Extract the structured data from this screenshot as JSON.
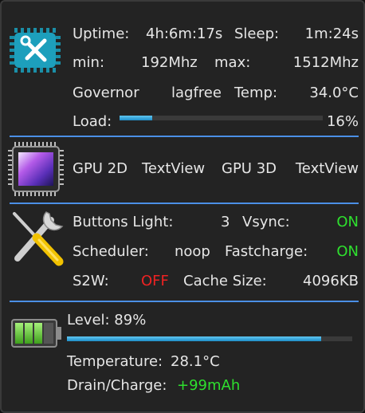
{
  "cpu": {
    "uptime_label": "Uptime:",
    "uptime_value": "4h:6m:17s",
    "sleep_label": "Sleep:",
    "sleep_value": "1m:24s",
    "min_label": "min:",
    "min_value": "192Mhz",
    "max_label": "max:",
    "max_value": "1512Mhz",
    "governor_label": "Governor",
    "governor_value": "lagfree",
    "temp_label": "Temp:",
    "temp_value": "34.0°C",
    "load_label": "Load:",
    "load_value": "16%",
    "load_fraction": 0.16,
    "icon": "cpu-chip-tools-icon"
  },
  "gpu": {
    "gpu2d_label": "GPU 2D",
    "gpu2d_value": "TextView",
    "gpu3d_label": "GPU 3D",
    "gpu3d_value": "TextView",
    "icon": "gpu-chip-icon"
  },
  "tweaks": {
    "buttons_light_label": "Buttons Light:",
    "buttons_light_value": "3",
    "vsync_label": "Vsync:",
    "vsync_value": "ON",
    "scheduler_label": "Scheduler:",
    "scheduler_value": "noop",
    "fastcharge_label": "Fastcharge:",
    "fastcharge_value": "ON",
    "s2w_label": "S2W:",
    "s2w_value": "OFF",
    "cache_label": "Cache Size:",
    "cache_value": "4096KB",
    "icon": "wrench-screwdriver-icon"
  },
  "battery": {
    "level_text": "Level: 89%",
    "level_fraction": 0.89,
    "temperature_label": "Temperature:",
    "temperature_value": "28.1°C",
    "drain_label": "Drain/Charge:",
    "drain_value": "+99mAh",
    "icon": "battery-icon"
  },
  "colors": {
    "accent": "#4b8fe6",
    "on": "#2ee02e",
    "off": "#ee2222",
    "bar": "#1e8ec8"
  }
}
